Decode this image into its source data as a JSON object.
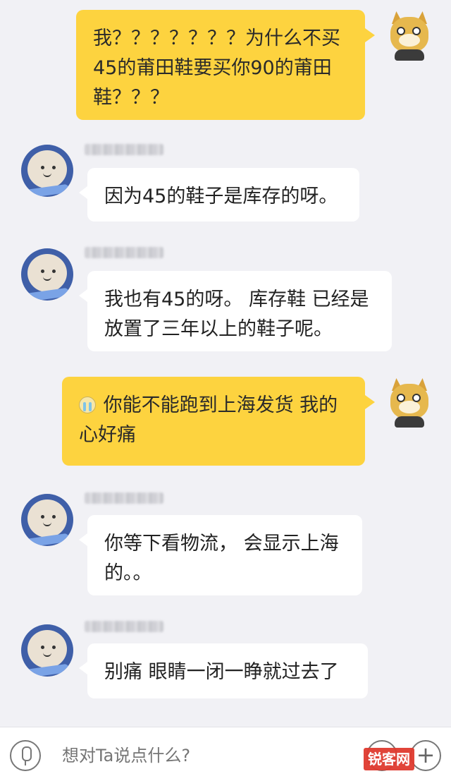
{
  "messages": [
    {
      "from": "me",
      "text": "我？？？？？？？为什么不买45的莆田鞋要买你90的莆田鞋？？？"
    },
    {
      "from": "them",
      "text": "因为45的鞋子是库存的呀。"
    },
    {
      "from": "them",
      "text": "我也有45的呀。 库存鞋 已经是放置了三年以上的鞋子呢。"
    },
    {
      "from": "me",
      "emoji": "crying-emoji",
      "text": "你能不能跑到上海发货 我的心好痛"
    },
    {
      "from": "them",
      "text": "你等下看物流， 会显示上海的。。"
    },
    {
      "from": "them",
      "text": "别痛  眼睛一闭一睁就过去了"
    }
  ],
  "input": {
    "placeholder": "想对Ta说点什么?"
  },
  "watermark": {
    "text": "锐客网"
  },
  "colors": {
    "me_bubble": "#fdd33f",
    "them_bubble": "#ffffff",
    "background": "#f1f1f5"
  },
  "icons": {
    "mic": "microphone-icon",
    "emoji": "emoji-icon",
    "plus": "plus-icon"
  }
}
